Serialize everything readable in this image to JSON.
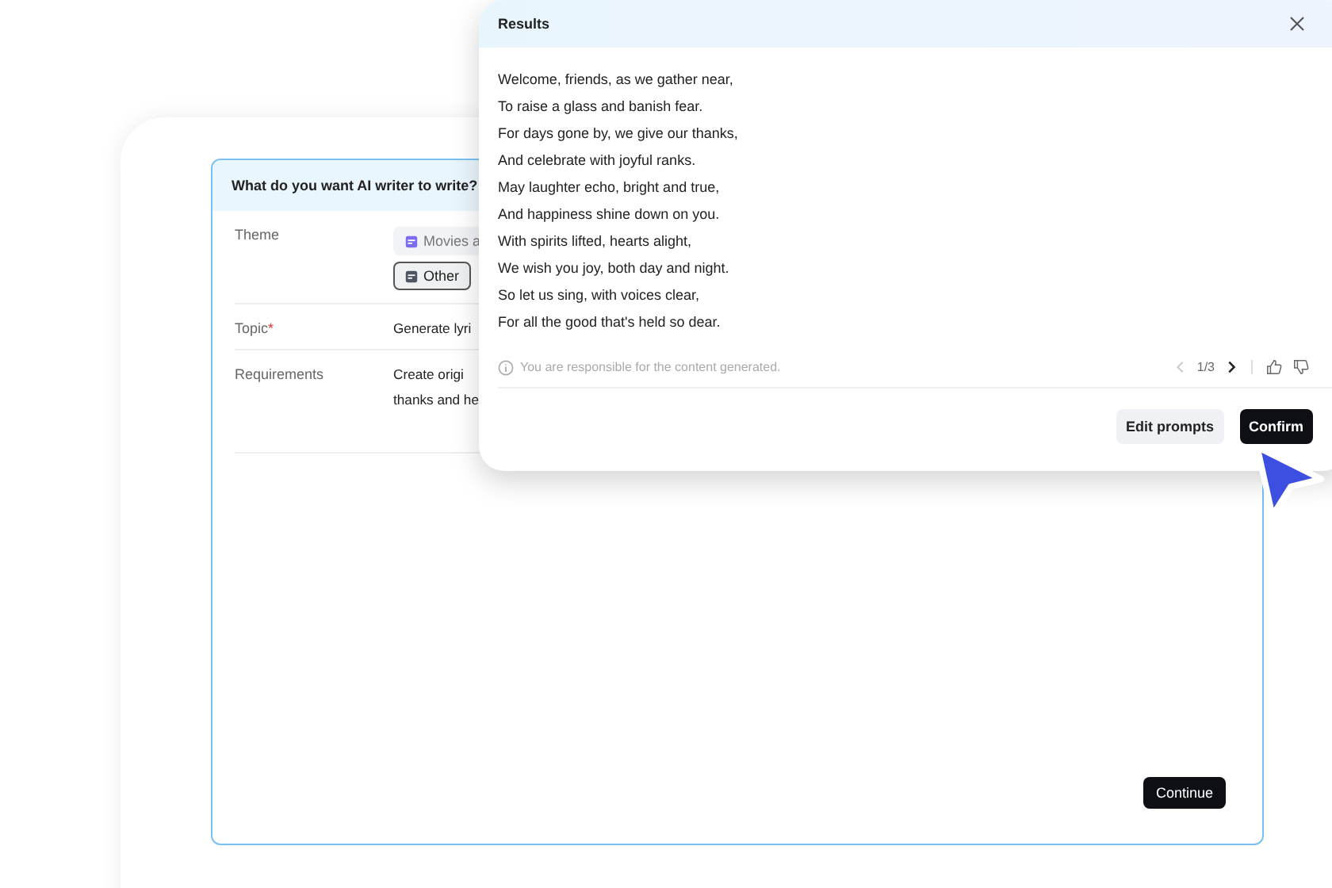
{
  "form": {
    "title": "What do you want AI writer to write?",
    "theme": {
      "label": "Theme",
      "chips": [
        {
          "label": "Movies a",
          "selected": false
        },
        {
          "label": "Other",
          "selected": true
        }
      ]
    },
    "topic": {
      "label": "Topic",
      "required_mark": "*",
      "value": "Generate lyri"
    },
    "requirements": {
      "label": "Requirements",
      "lines": [
        "Create origi",
        "thanks and he"
      ]
    },
    "continue_button": "Continue"
  },
  "results": {
    "title": "Results",
    "lines": [
      "Welcome, friends, as we gather near,",
      "To raise a glass and banish fear.",
      "For days gone by, we give our thanks,",
      "And celebrate with joyful ranks.",
      "May laughter echo, bright and true,",
      "And happiness shine down on you.",
      "With spirits lifted, hearts alight,",
      "We wish you joy, both day and night.",
      "So let us sing, with voices clear,",
      "For all the good that's held so dear."
    ],
    "notice": "You are responsible for the content generated.",
    "pager": {
      "text": "1/3",
      "prev_disabled": true,
      "next_disabled": false
    },
    "buttons": [
      {
        "label": "Edit prompts",
        "kind": "secondary"
      },
      {
        "label": "Confirm",
        "kind": "primary"
      }
    ]
  }
}
